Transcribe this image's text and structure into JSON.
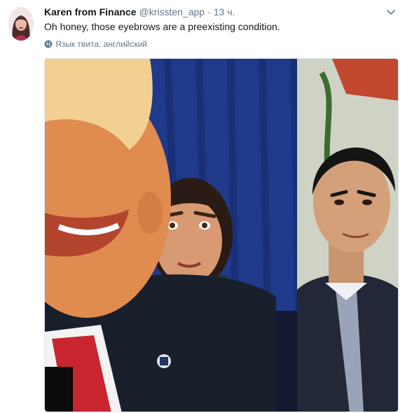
{
  "tweet": {
    "author": {
      "name": "Karen from Finance",
      "handle": "@krissten_app",
      "avatar_icon": "user-avatar"
    },
    "separator": "·",
    "time": "13 ч.",
    "text": "Oh honey, those eyebrows are a preexisting condition.",
    "translate_label": "Язык твита: английский",
    "menu_icon": "chevron-down-icon",
    "media": {
      "type": "video-still",
      "description_icon": "photo"
    }
  },
  "colors": {
    "text_primary": "#14171a",
    "text_secondary": "#657786",
    "border": "#e1e8ed",
    "background": "#ffffff"
  }
}
